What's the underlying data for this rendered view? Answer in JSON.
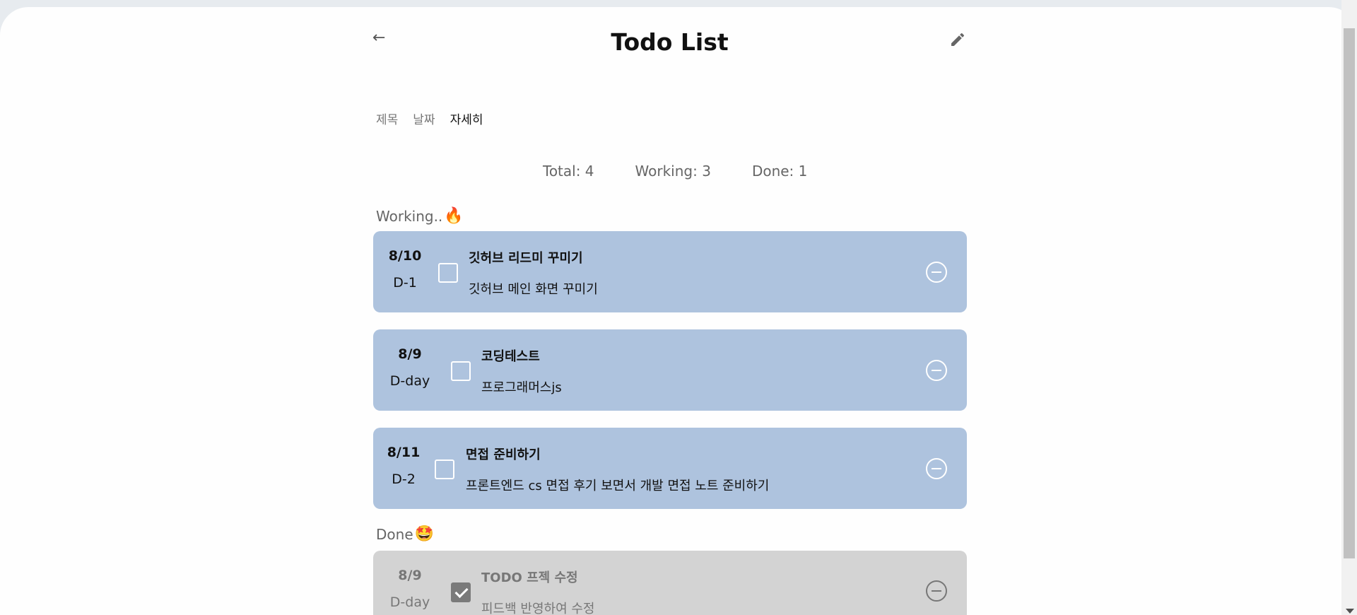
{
  "header": {
    "back_icon": "arrow-left-icon",
    "title": "Todo List",
    "edit_icon": "pencil-icon"
  },
  "sort_tabs": [
    {
      "label": "제목",
      "active": false
    },
    {
      "label": "날짜",
      "active": false
    },
    {
      "label": "자세히",
      "active": true
    }
  ],
  "stats": {
    "total": "Total: 4",
    "working": "Working: 3",
    "done": "Done: 1"
  },
  "sections": {
    "working_label": "Working..",
    "working_emoji": "🔥",
    "done_label": "Done",
    "done_emoji": "🤩"
  },
  "working_todos": [
    {
      "date": "8/10",
      "dday": "D-1",
      "title": "깃허브 리드미 꾸미기",
      "detail": "깃허브 메인 화면 꾸미기",
      "checked": false
    },
    {
      "date": "8/9",
      "dday": "D-day",
      "title": "코딩테스트",
      "detail": "프로그래머스js",
      "checked": false
    },
    {
      "date": "8/11",
      "dday": "D-2",
      "title": "면접 준비하기",
      "detail": "프론트엔드 cs 면접 후기 보면서 개발 면접 노트 준비하기",
      "checked": false
    }
  ],
  "done_todos": [
    {
      "date": "8/9",
      "dday": "D-day",
      "title": "TODO 프젝 수정",
      "detail": "피드백 반영하여 수정",
      "checked": true
    }
  ],
  "colors": {
    "card_working": "#aec3de",
    "card_done": "#d3d3d3"
  }
}
